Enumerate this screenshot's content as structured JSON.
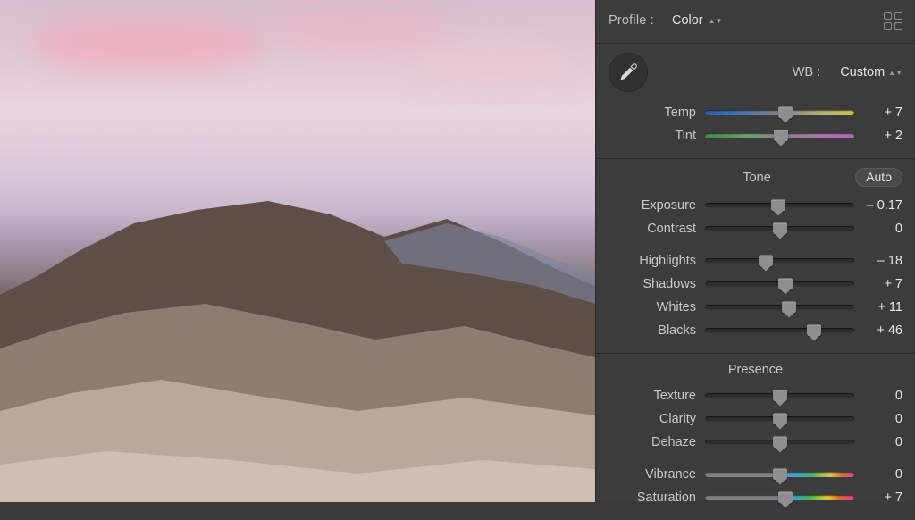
{
  "profile": {
    "label": "Profile :",
    "value": "Color"
  },
  "wb": {
    "label": "WB :",
    "value": "Custom"
  },
  "temp": {
    "label": "Temp",
    "value": "+ 7",
    "pos": 54
  },
  "tint": {
    "label": "Tint",
    "value": "+ 2",
    "pos": 51
  },
  "tone": {
    "title": "Tone",
    "auto": "Auto",
    "exposure": {
      "label": "Exposure",
      "value": "– 0.17",
      "pos": 49
    },
    "contrast": {
      "label": "Contrast",
      "value": "0",
      "pos": 50
    },
    "highlights": {
      "label": "Highlights",
      "value": "– 18",
      "pos": 41
    },
    "shadows": {
      "label": "Shadows",
      "value": "+ 7",
      "pos": 54
    },
    "whites": {
      "label": "Whites",
      "value": "+ 11",
      "pos": 56
    },
    "blacks": {
      "label": "Blacks",
      "value": "+ 46",
      "pos": 73
    }
  },
  "presence": {
    "title": "Presence",
    "texture": {
      "label": "Texture",
      "value": "0",
      "pos": 50
    },
    "clarity": {
      "label": "Clarity",
      "value": "0",
      "pos": 50
    },
    "dehaze": {
      "label": "Dehaze",
      "value": "0",
      "pos": 50
    },
    "vibrance": {
      "label": "Vibrance",
      "value": "0",
      "pos": 50
    },
    "saturation": {
      "label": "Saturation",
      "value": "+ 7",
      "pos": 54
    }
  }
}
